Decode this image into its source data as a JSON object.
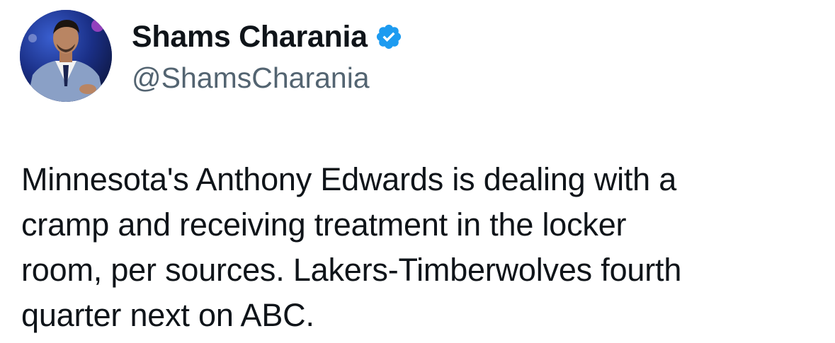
{
  "tweet": {
    "author": {
      "display_name": "Shams Charania",
      "handle": "@ShamsCharania",
      "verified": true,
      "verified_color": "#1d9bf0"
    },
    "text_lines": [
      "Minnesota's Anthony Edwards is dealing with a",
      "cramp and receiving treatment in the locker",
      "room, per sources. Lakers-Timberwolves fourth",
      "quarter next on ABC."
    ]
  },
  "icons": {
    "verified": "verified-badge-icon",
    "avatar": "profile-photo"
  }
}
